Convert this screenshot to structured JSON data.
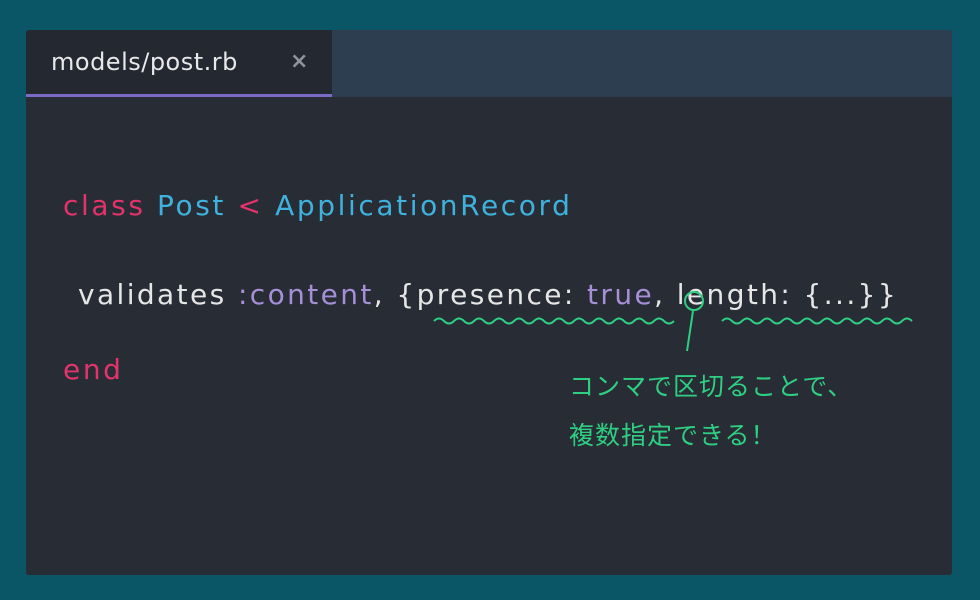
{
  "tab": {
    "title": "models/post.rb",
    "close": "×"
  },
  "code": {
    "line1": {
      "keyword": "class",
      "class_name": "Post",
      "operator": "<",
      "parent": "ApplicationRecord"
    },
    "line2": {
      "method": "validates",
      "symbol": ":content",
      "sep1": ", {",
      "presence_key": "presence:",
      "presence_value": "true",
      "comma": ",",
      "length_key": "length:",
      "length_value": "{...}}"
    },
    "line3": {
      "keyword": "end"
    }
  },
  "annotation": {
    "line1": "コンマで区切ることで、",
    "line2": "複数指定できる！"
  },
  "colors": {
    "background": "#0b5666",
    "editor": "#282c34",
    "keyword": "#e2336b",
    "type": "#3fb1dd",
    "symbol": "#a58fd6",
    "annotation": "#2fcf83",
    "tab_accent": "#7b6bc4"
  }
}
